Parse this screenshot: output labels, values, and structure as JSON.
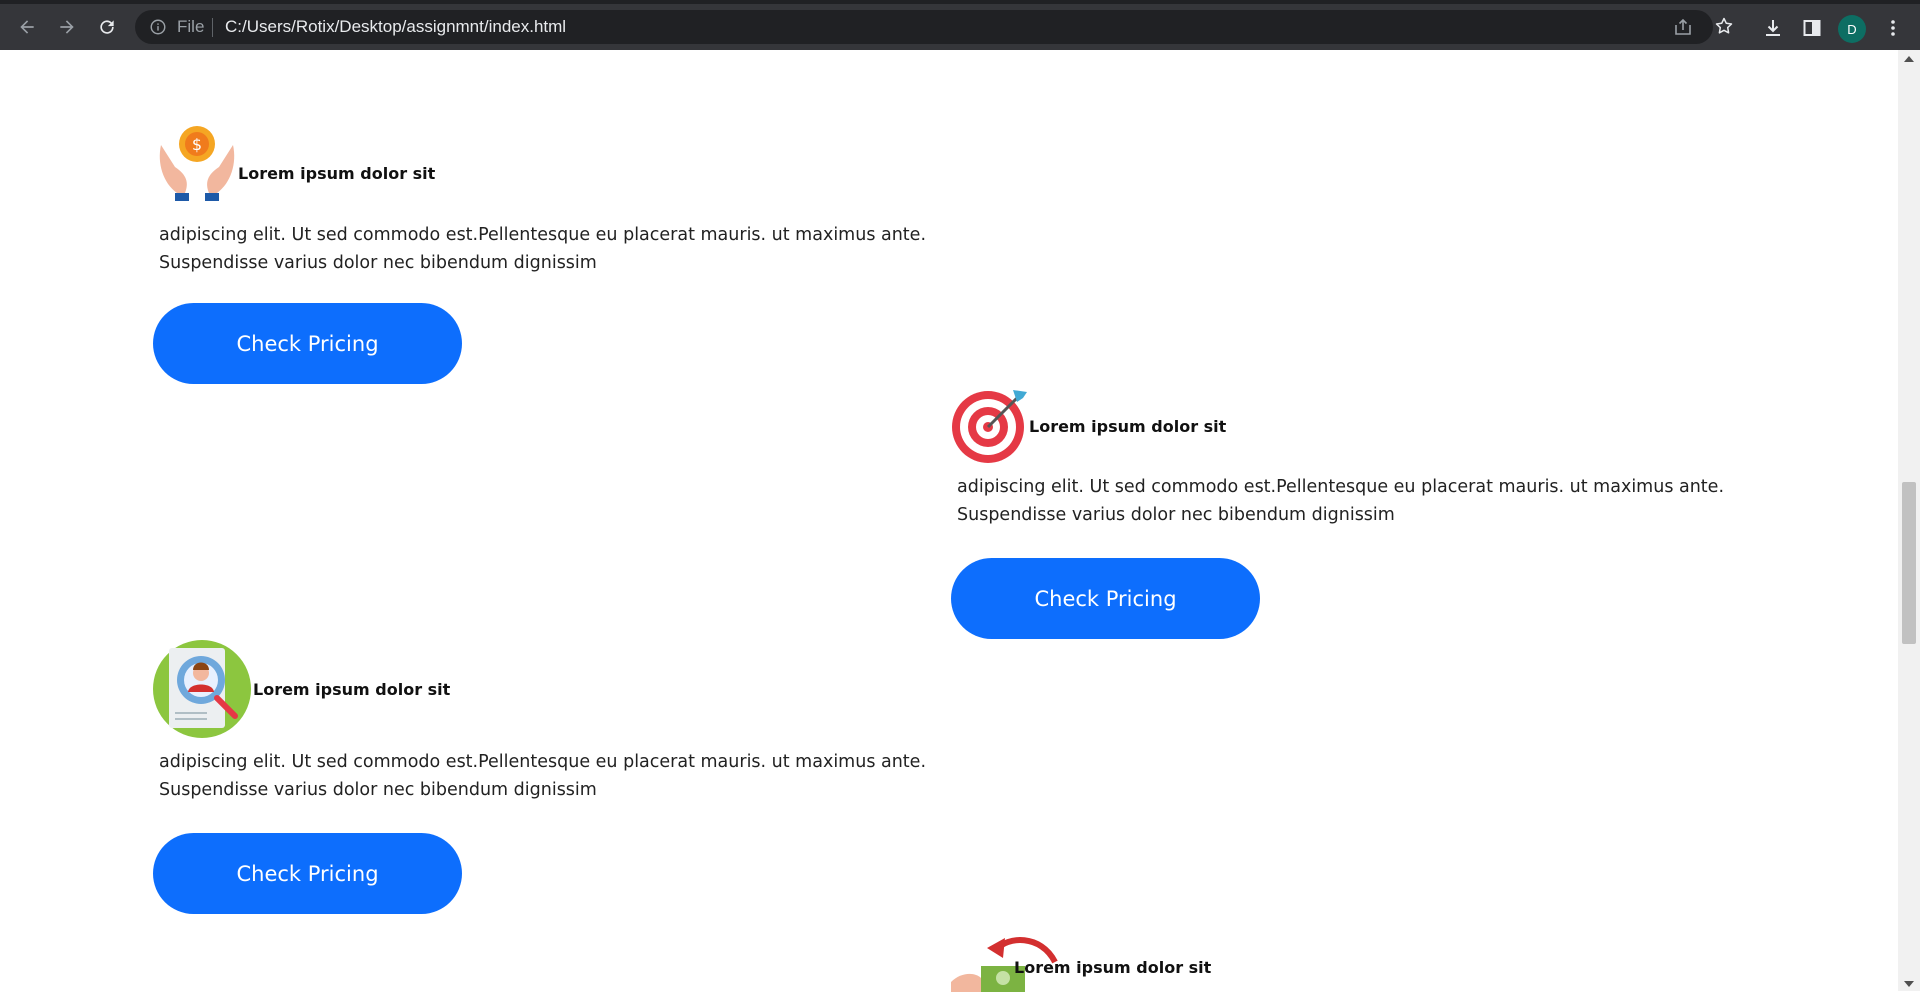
{
  "browser": {
    "protocol_label": "File",
    "url": "C:/Users/Rotix/Desktop/assignmnt/index.html",
    "avatar_initial": "D",
    "icons": [
      "back-icon",
      "forward-icon",
      "reload-icon",
      "info-icon",
      "share-icon",
      "bookmark-star-icon",
      "download-icon",
      "side-panel-icon",
      "menu-icon"
    ]
  },
  "cards": [
    {
      "icon": "money-hands-icon",
      "title": "Lorem ipsum dolor sit",
      "text_line1": "adipiscing elit. Ut sed commodo est.Pellentesque eu placerat mauris. ut maximus ante.",
      "text_line2": "Suspendisse varius dolor nec bibendum dignissim",
      "button": "Check Pricing"
    },
    {
      "icon": "target-dart-icon",
      "title": "Lorem ipsum dolor sit",
      "text_line1": "adipiscing elit. Ut sed commodo est.Pellentesque eu placerat mauris. ut maximus ante.",
      "text_line2": "Suspendisse varius dolor nec bibendum dignissim",
      "button": "Check Pricing"
    },
    {
      "icon": "profile-search-icon",
      "title": "Lorem ipsum dolor sit",
      "text_line1": "adipiscing elit. Ut sed commodo est.Pellentesque eu placerat mauris. ut maximus ante.",
      "text_line2": "Suspendisse varius dolor nec bibendum dignissim",
      "button": "Check Pricing"
    },
    {
      "icon": "cash-refund-icon",
      "title": "Lorem ipsum dolor sit"
    }
  ],
  "colors": {
    "button": "#0d6efd",
    "chrome": "#35363a",
    "omnibox": "#202124"
  }
}
